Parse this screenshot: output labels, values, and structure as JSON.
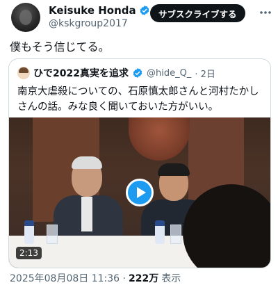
{
  "author": {
    "name": "Keisuke Honda",
    "handle": "@kskgroup2017"
  },
  "subscribe_label": "サブスクライブする",
  "tweet_text": "僕もそう信じてる。",
  "quote": {
    "name": "ひで2022真実を追求",
    "handle": "@hide_Q_",
    "time": "· 2日",
    "text": "南京大虐殺についての、石原慎太郎さんと河村たかしさんの話。みな良く聞いておいた方がいい。",
    "video_duration": "2:13"
  },
  "meta": {
    "timestamp": "2025年08月08日 11:36 ·",
    "views_count": "222万",
    "views_label": "表示"
  },
  "colors": {
    "accent": "#1d9bf0",
    "text": "#0f1419",
    "muted": "#536471"
  },
  "icons": [
    "verified-icon",
    "more-icon",
    "play-icon"
  ]
}
